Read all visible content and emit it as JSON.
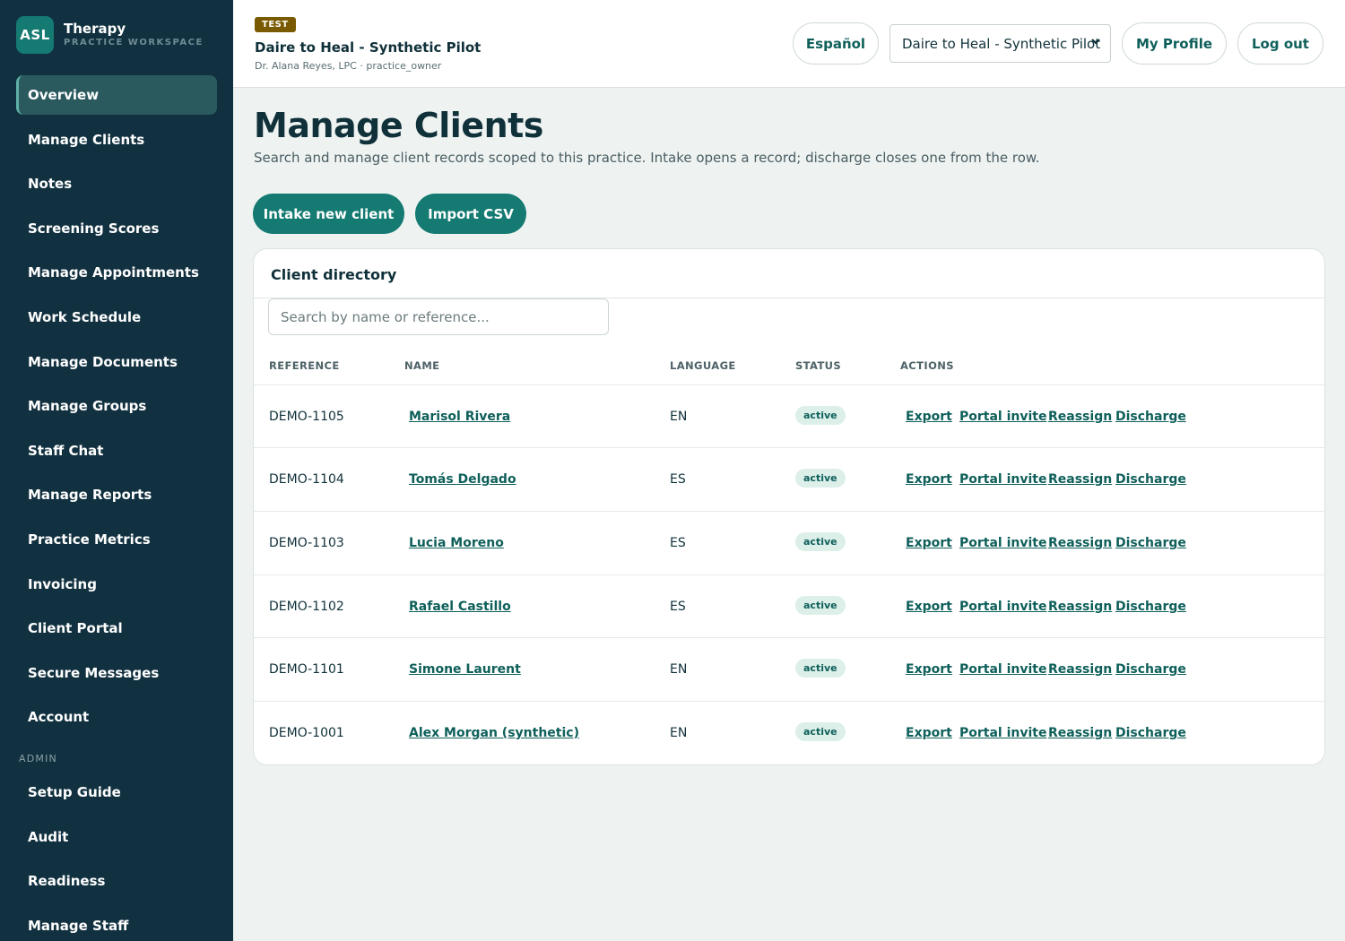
{
  "brand": {
    "logo": "ASL",
    "title": "Therapy",
    "subtitle": "PRACTICE WORKSPACE"
  },
  "sidebar": {
    "items": [
      {
        "label": "Overview",
        "active": true
      },
      {
        "label": "Manage Clients"
      },
      {
        "label": "Notes"
      },
      {
        "label": "Screening Scores"
      },
      {
        "label": "Manage Appointments"
      },
      {
        "label": "Work Schedule"
      },
      {
        "label": "Manage Documents"
      },
      {
        "label": "Manage Groups"
      },
      {
        "label": "Staff Chat"
      },
      {
        "label": "Manage Reports"
      },
      {
        "label": "Practice Metrics"
      },
      {
        "label": "Invoicing"
      },
      {
        "label": "Client Portal"
      },
      {
        "label": "Secure Messages"
      },
      {
        "label": "Account"
      }
    ],
    "admin_heading": "ADMIN",
    "admin_items": [
      {
        "label": "Setup Guide"
      },
      {
        "label": "Audit"
      },
      {
        "label": "Readiness"
      },
      {
        "label": "Manage Staff"
      }
    ]
  },
  "header": {
    "badge": "TEST",
    "title": "Daire to Heal - Synthetic Pilot",
    "subtitle": "Dr. Alana Reyes, LPC · practice_owner",
    "language_button": "Español",
    "practice_select": "Daire to Heal - Synthetic Pilot",
    "profile_button": "My Profile",
    "logout_button": "Log out"
  },
  "main": {
    "title": "Manage Clients",
    "description": "Search and manage client records scoped to this practice. Intake opens a record; discharge closes one from the row.",
    "intake_button": "Intake new client",
    "import_button": "Import CSV"
  },
  "directory": {
    "title": "Client directory",
    "search_placeholder": "Search by name or reference...",
    "columns": [
      "REFERENCE",
      "NAME",
      "LANGUAGE",
      "STATUS",
      "ACTIONS"
    ],
    "actions": [
      "Export",
      "Portal invite",
      "Reassign",
      "Discharge"
    ],
    "rows": [
      {
        "reference": "DEMO-1105",
        "name": "Marisol Rivera",
        "language": "EN",
        "status": "active"
      },
      {
        "reference": "DEMO-1104",
        "name": "Tomás Delgado",
        "language": "ES",
        "status": "active"
      },
      {
        "reference": "DEMO-1103",
        "name": "Lucia Moreno",
        "language": "ES",
        "status": "active"
      },
      {
        "reference": "DEMO-1102",
        "name": "Rafael Castillo",
        "language": "ES",
        "status": "active"
      },
      {
        "reference": "DEMO-1101",
        "name": "Simone Laurent",
        "language": "EN",
        "status": "active"
      },
      {
        "reference": "DEMO-1001",
        "name": "Alex Morgan (synthetic)",
        "language": "EN",
        "status": "active"
      }
    ]
  },
  "colors": {
    "sidebar": "#123140",
    "accent": "#147a72",
    "link": "#0e5f5a",
    "badge": "#7a5a00"
  }
}
